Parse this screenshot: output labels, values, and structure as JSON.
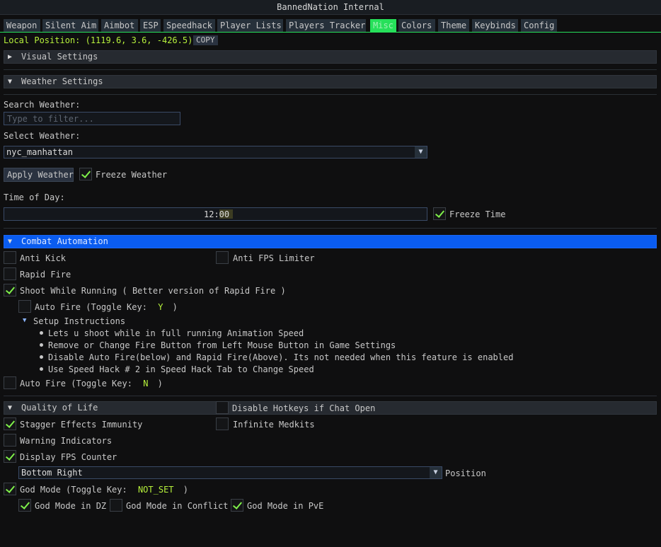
{
  "window": {
    "title": "BannedNation Internal"
  },
  "tabs": [
    {
      "label": "Weapon",
      "active": false
    },
    {
      "label": "Silent Aim",
      "active": false
    },
    {
      "label": "Aimbot",
      "active": false
    },
    {
      "label": "ESP",
      "active": false
    },
    {
      "label": "Speedhack",
      "active": false
    },
    {
      "label": "Player Lists",
      "active": false
    },
    {
      "label": "Players Tracker",
      "active": false
    },
    {
      "label": "Misc",
      "active": true
    },
    {
      "label": "Colors",
      "active": false
    },
    {
      "label": "Theme",
      "active": false
    },
    {
      "label": "Keybinds",
      "active": false
    },
    {
      "label": "Config",
      "active": false
    }
  ],
  "position": {
    "label": "Local Position: (1119.6, 3.6, -426.5)",
    "copy_label": "COPY"
  },
  "visual_settings": {
    "label": "Visual Settings",
    "expanded": false
  },
  "weather": {
    "header": "Weather Settings",
    "search_label": "Search Weather:",
    "search_placeholder": "Type to filter...",
    "select_label": "Select Weather:",
    "selected": "nyc_manhattan",
    "apply_label": "Apply Weather",
    "freeze_label": "Freeze Weather",
    "freeze_checked": true,
    "time_label": "Time of Day:",
    "time_value": "12:00",
    "time_fraction": 0.5,
    "freeze_time_label": "Freeze Time",
    "freeze_time_checked": true
  },
  "combat": {
    "header": "Combat Automation",
    "anti_kick": {
      "label": "Anti Kick",
      "checked": false
    },
    "anti_fps": {
      "label": "Anti FPS Limiter",
      "checked": false
    },
    "rapid_fire": {
      "label": "Rapid Fire",
      "checked": false
    },
    "shoot_running": {
      "label": "Shoot While Running ( Better version of Rapid Fire )",
      "checked": true
    },
    "auto_fire_inner": {
      "label": "Auto Fire (Toggle Key:",
      "key": "Y",
      "close": ")",
      "checked": false
    },
    "setup_header": "Setup Instructions",
    "instructions": [
      "Lets u shoot while in full running Animation Speed",
      "Remove or Change Fire Button from Left Mouse Button in Game Settings",
      "Disable Auto Fire(below) and Rapid Fire(Above). Its not needed when this feature is enabled",
      "Use Speed Hack # 2 in Speed Hack Tab to Change Speed"
    ],
    "auto_fire": {
      "label": "Auto Fire (Toggle Key:",
      "key": "N",
      "close": ")",
      "checked": false
    }
  },
  "qol": {
    "header": "Quality of Life",
    "disable_hotkeys": {
      "label": "Disable Hotkeys if Chat Open",
      "checked": false
    },
    "stagger": {
      "label": "Stagger Effects Immunity",
      "checked": true
    },
    "medkits": {
      "label": "Infinite Medkits",
      "checked": false
    },
    "warning": {
      "label": "Warning Indicators",
      "checked": false
    },
    "fps_counter": {
      "label": "Display FPS Counter",
      "checked": true
    },
    "position_value": "Bottom Right",
    "position_label": "Position",
    "god_mode": {
      "label": "God Mode (Toggle Key:",
      "key": "NOT_SET",
      "close": ")",
      "checked": true
    },
    "god_dz": {
      "label": "God Mode in DZ",
      "checked": true
    },
    "god_conflict": {
      "label": "God Mode in Conflict",
      "checked": false
    },
    "god_pve": {
      "label": "God Mode in PvE",
      "checked": true
    }
  },
  "colors": {
    "accent": "#26e05a",
    "check": "#7ff04a",
    "key": "#b7f23c",
    "header_active": "#0a5cf0"
  }
}
